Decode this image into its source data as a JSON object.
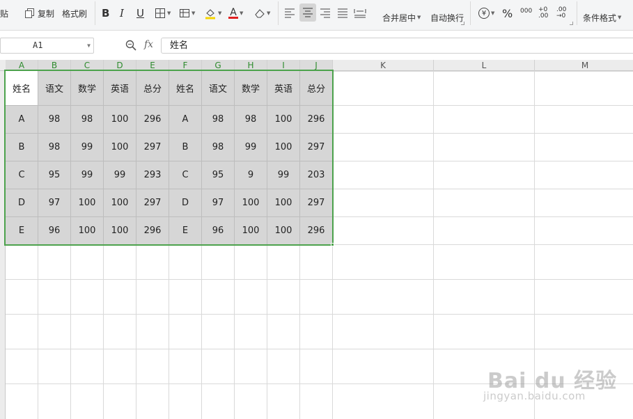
{
  "toolbar": {
    "paste_label": "粘贴",
    "copy_label": "复制",
    "format_painter_label": "格式刷",
    "bold_label": "B",
    "italic_label": "I",
    "underline_label": "U",
    "font_color_label": "A",
    "merge_label": "合并居中",
    "wrap_label": "自动换行",
    "currency_symbol": "¥",
    "percent_label": "%",
    "thousands_label": "000",
    "inc_decimal_label": "+0 .00",
    "dec_decimal_label": ".00 →0",
    "cond_format_label": "条件格式",
    "accent_color": "#47a047"
  },
  "formula_bar": {
    "cell_ref": "A1",
    "fx_label": "fx",
    "content": "姓名"
  },
  "columns": [
    "A",
    "B",
    "C",
    "D",
    "E",
    "F",
    "G",
    "H",
    "I",
    "J",
    "K",
    "L",
    "M"
  ],
  "table": [
    [
      "姓名",
      "语文",
      "数学",
      "英语",
      "总分",
      "姓名",
      "语文",
      "数学",
      "英语",
      "总分"
    ],
    [
      "A",
      "98",
      "98",
      "100",
      "296",
      "A",
      "98",
      "98",
      "100",
      "296"
    ],
    [
      "B",
      "98",
      "99",
      "100",
      "297",
      "B",
      "98",
      "99",
      "100",
      "297"
    ],
    [
      "C",
      "95",
      "99",
      "99",
      "293",
      "C",
      "95",
      "9",
      "99",
      "203"
    ],
    [
      "D",
      "97",
      "100",
      "100",
      "297",
      "D",
      "97",
      "100",
      "100",
      "297"
    ],
    [
      "E",
      "96",
      "100",
      "100",
      "296",
      "E",
      "96",
      "100",
      "100",
      "296"
    ]
  ],
  "watermark": {
    "main": "Bai du 经验",
    "sub": "jingyan.baidu.com"
  }
}
